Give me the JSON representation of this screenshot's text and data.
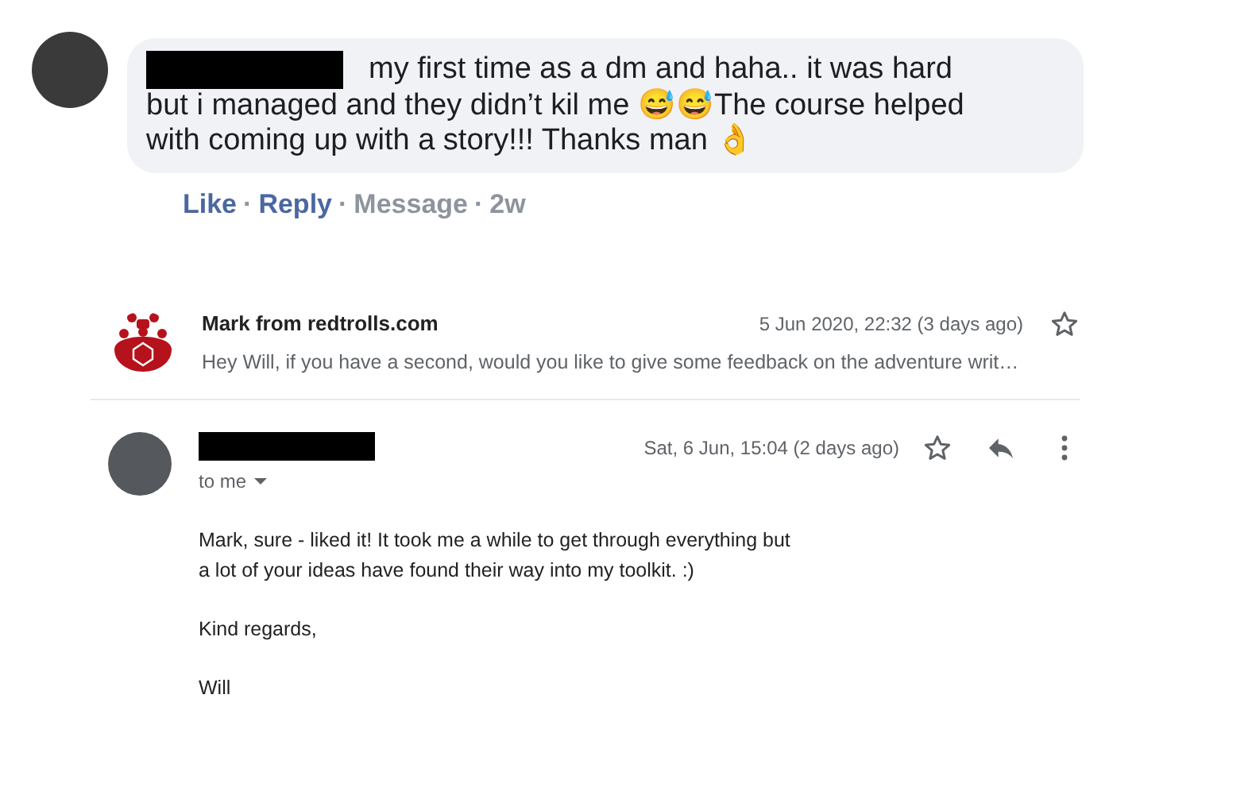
{
  "comment": {
    "author_redacted": true,
    "text": "my first time as a dm and haha.. it was hard but i managed and they didn’t kil me 😅😅The course helped with coming up with a story!!! Thanks man 👌",
    "separator": "·",
    "actions": [
      {
        "label": "Like",
        "kind": "link"
      },
      {
        "label": "Reply",
        "kind": "link"
      },
      {
        "label": "Message",
        "kind": "muted"
      },
      {
        "label": "2w",
        "kind": "muted"
      }
    ]
  },
  "emails": [
    {
      "kind": "collapsed",
      "sender": "Mark from redtrolls.com",
      "date": "5 Jun 2020, 22:32 (3 days ago)",
      "starred": false,
      "snippet": "Hey Will, if you have a second, would you like to give some feedback on the adventure writ…"
    },
    {
      "kind": "expanded",
      "sender_redacted": true,
      "date": "Sat, 6 Jun, 15:04 (2 days ago)",
      "starred": false,
      "recipient": "to me",
      "paragraphs": [
        [
          "Mark, sure - liked it! It took me a while to get through everything but",
          "a lot of your ideas have found their way into my toolkit. :)"
        ],
        [
          "Kind regards,"
        ],
        [
          "Will"
        ]
      ]
    }
  ]
}
